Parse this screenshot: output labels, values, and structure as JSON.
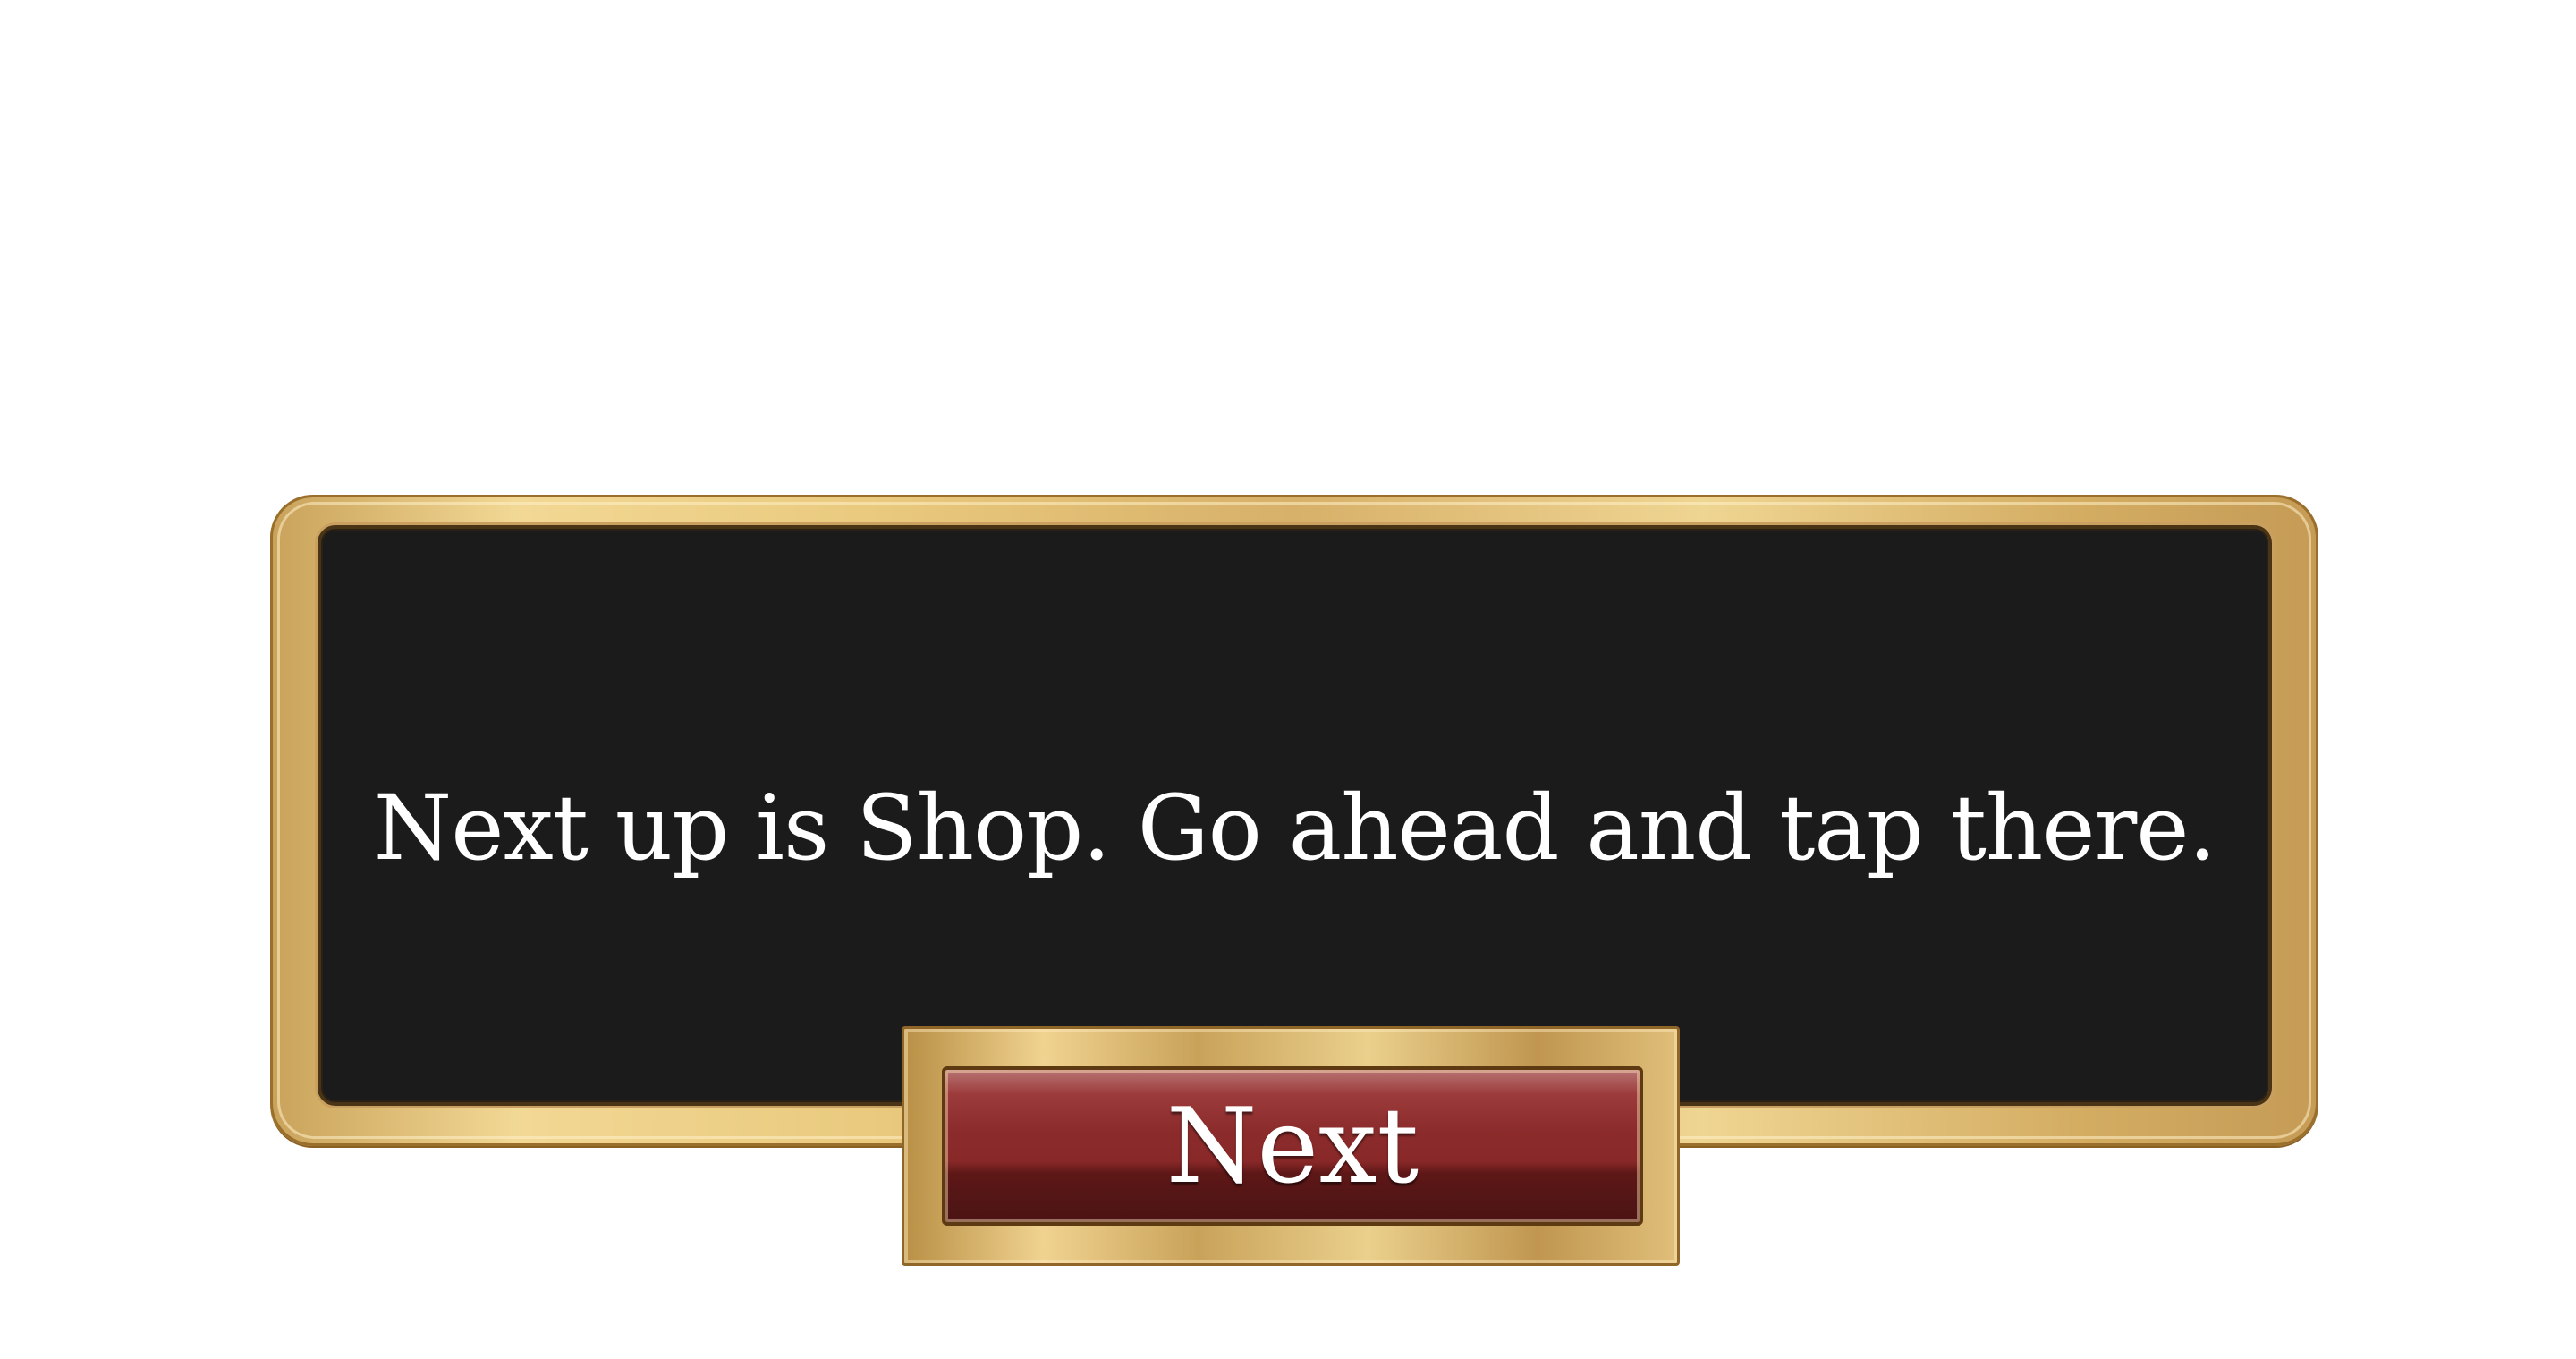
{
  "dialog": {
    "message": "Next up is Shop. Go ahead and tap there."
  },
  "buttons": {
    "next_label": "Next"
  },
  "colors": {
    "background": "#ffffff",
    "panel": "#1b1b1b",
    "frame_gold": "#e9c97d",
    "button_red": "#8c2b2b",
    "text": "#ffffff"
  }
}
